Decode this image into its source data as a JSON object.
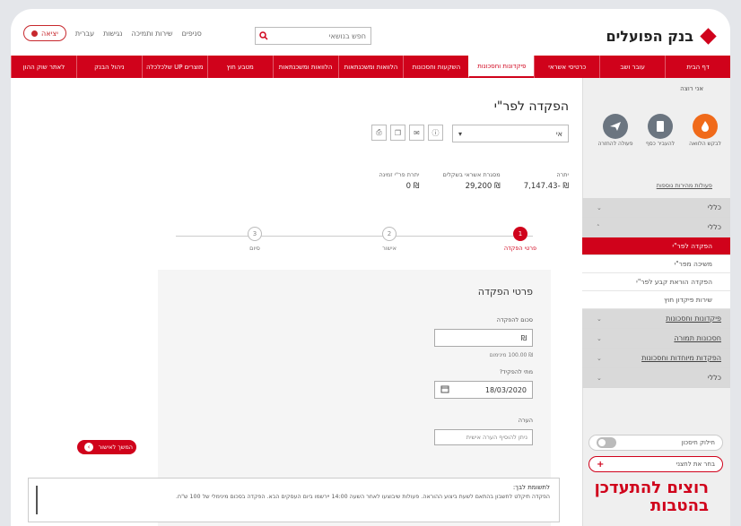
{
  "header": {
    "bank_name": "בנק הפועלים",
    "exit_label": "יציאה",
    "top_links": [
      "עברית",
      "נגישות",
      "שירות ותמיכה",
      "סניפים"
    ],
    "search_placeholder": "חפש בנושאי"
  },
  "nav": {
    "items": [
      {
        "label": "דף הבית",
        "active": false
      },
      {
        "label": "עובר ושב",
        "active": false
      },
      {
        "label": "כרטיסי אשראי",
        "active": false
      },
      {
        "label": "פיקדונות וחסכונות",
        "active": true
      },
      {
        "label": "השקעות וחסכונות",
        "active": false
      },
      {
        "label": "הלוואות ומשכנתאות",
        "active": false
      },
      {
        "label": "הלוואות ומשכנתאות",
        "active": false
      },
      {
        "label": "מטבע חוץ",
        "active": false
      },
      {
        "label": "מוצרים UP שלכלכלה",
        "active": false
      },
      {
        "label": "ניהול הבנק",
        "active": false
      },
      {
        "label": "לאתר שוק ההון",
        "active": false
      }
    ]
  },
  "sidebar": {
    "greeting": "אני רוצה",
    "quick_actions": [
      {
        "label": "לבקש הלוואה",
        "color": "#f06a1a",
        "icon": "flame-icon"
      },
      {
        "label": "להעביר כסף",
        "color": "#6b7580",
        "icon": "card-icon"
      },
      {
        "label": "פעולה להחזרה",
        "color": "#6b7580",
        "icon": "send-icon"
      }
    ],
    "more_actions": "פעולות מהירות נוספות",
    "menu": [
      {
        "label": "כללי",
        "type": "header"
      },
      {
        "label": "כללי",
        "type": "header"
      },
      {
        "label": "הפקדה לפר\"י",
        "type": "sub",
        "active": true
      },
      {
        "label": "משיכה מפר\"י",
        "type": "sub",
        "active": false
      },
      {
        "label": "הפקדה הוראת קבע לפר\"י",
        "type": "sub",
        "active": false
      },
      {
        "label": "שירות פיקדון חוץ",
        "type": "sub",
        "active": false
      },
      {
        "label": "פיקדונות וחסכונות",
        "type": "header"
      },
      {
        "label": "חסכונות תמורה",
        "type": "header"
      },
      {
        "label": "הפקדות מיוחדות וחסכונות",
        "type": "header"
      },
      {
        "label": "כללי",
        "type": "header"
      }
    ],
    "toggle_label": "חילוק חיסכון",
    "join_label": "בחר את לחצני",
    "promo_line1": "רוצים להתעדכן",
    "promo_line2": "בהטבות"
  },
  "main": {
    "title": "הפקדה לפר\"י",
    "account": "אי",
    "tools": [
      "print-icon",
      "copy-icon",
      "mail-icon",
      "info-icon"
    ],
    "balances": [
      {
        "label": "יתרה",
        "value": "₪ -7,147.43"
      },
      {
        "label": "מסגרת אשראי בשקלים",
        "value": "₪ 29,200"
      },
      {
        "label": "יתרת פר\"י זמינה",
        "value": "₪ 0"
      }
    ],
    "steps": [
      {
        "num": "1",
        "label": "פרטי הפקדה",
        "active": true
      },
      {
        "num": "2",
        "label": "אישור",
        "active": false
      },
      {
        "num": "3",
        "label": "סיום",
        "active": false
      }
    ],
    "form": {
      "title": "פרטי הפקדה",
      "amount_label": "סכום להפקדה",
      "amount_value": "",
      "amount_hint": "₪ 100.00 מינימום",
      "date_label": "מתי להפקיד?",
      "date_value": "18/03/2020",
      "note_label": "הערה",
      "note_placeholder": "ניתן להוסיף הערה אישית",
      "continue_label": "המשך לאישור"
    },
    "notice": {
      "title": "לתשומת לבך:",
      "text": "הפקדה תיקלט לחשבון בהתאם לשעת ביצוע ההוראה. פעולות שיבוצעו לאחר השעה 14:00 יירשמו ביום העסקים הבא. הפקדה בסכום מינימלי של 100 ש\"ח."
    }
  }
}
